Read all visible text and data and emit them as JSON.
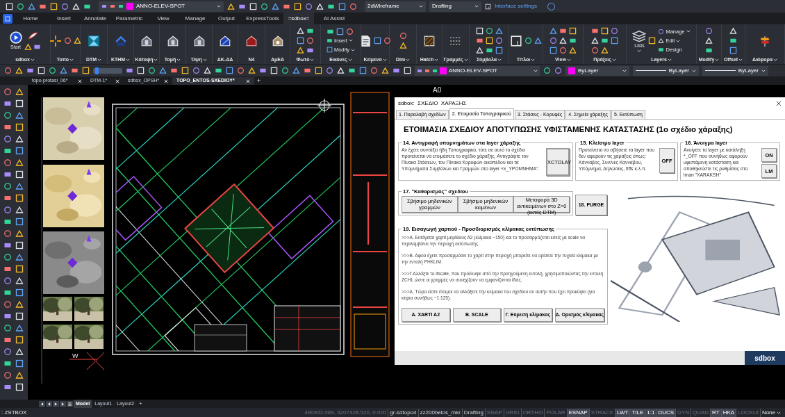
{
  "quick_access": {
    "layer": "ANNO-ELEV-SPOT",
    "visual_style": "2dWireframe",
    "workspace": "Drafting",
    "link": "Interface settings"
  },
  "ribbon_tabs": [
    {
      "label": "Home",
      "selected": false
    },
    {
      "label": "Insert",
      "selected": false
    },
    {
      "label": "Annotate",
      "selected": false
    },
    {
      "label": "Parametric",
      "selected": false
    },
    {
      "label": "View",
      "selected": false
    },
    {
      "label": "Manage",
      "selected": false
    },
    {
      "label": "Output",
      "selected": false
    },
    {
      "label": "ExpressTools",
      "selected": false
    },
    {
      "label": "=sdbox=",
      "selected": true
    },
    {
      "label": "AI Assist",
      "selected": false
    }
  ],
  "ribbon_panels": [
    {
      "label": "sdbox",
      "dropdown": true,
      "items": [
        {
          "kind": "caption",
          "label": "Start"
        }
      ]
    },
    {
      "label": "Τοπο",
      "dropdown": true
    },
    {
      "label": "DTM",
      "dropdown": true
    },
    {
      "label": "ΚΤΗΜ",
      "dropdown": true
    },
    {
      "label": "Κάτοψη",
      "dropdown": true
    },
    {
      "label": "Τομή",
      "dropdown": true
    },
    {
      "label": "Όψη",
      "dropdown": true
    },
    {
      "label": "ΔΚ-ΔΔ",
      "dropdown": false
    },
    {
      "label": "Ν4",
      "dropdown": false
    },
    {
      "label": "ΑμΕΑ",
      "dropdown": false
    },
    {
      "label": "Φωτό",
      "dropdown": true
    },
    {
      "label": "Εικόνες",
      "dropdown": true,
      "items": [
        {
          "kind": "row",
          "label": "Insert",
          "dropdown": true
        },
        {
          "kind": "row",
          "label": "Modify",
          "dropdown": true
        }
      ]
    },
    {
      "label": "Κείμενα",
      "dropdown": true
    },
    {
      "label": "Dim",
      "dropdown": true
    },
    {
      "label": "Hatch",
      "dropdown": true
    },
    {
      "label": "Γραμμές",
      "dropdown": true
    },
    {
      "label": "Σύμβολα",
      "dropdown": true
    },
    {
      "label": "Τίτλοι",
      "dropdown": true
    },
    {
      "label": "View",
      "dropdown": true
    },
    {
      "label": "Πράξεις",
      "dropdown": true
    },
    {
      "label": "Layers",
      "dropdown": true,
      "items": [
        {
          "kind": "caption",
          "label": "Lists",
          "dropdown": true
        },
        {
          "kind": "row",
          "label": "Manage",
          "dropdown": true
        },
        {
          "kind": "row",
          "label": "Edit",
          "dropdown": true
        },
        {
          "kind": "row",
          "label": "Design",
          "dropdown": false
        }
      ]
    },
    {
      "label": "Modify",
      "dropdown": true
    },
    {
      "label": "Offset",
      "dropdown": true
    },
    {
      "label": "Διάφορα",
      "dropdown": true
    }
  ],
  "properties_bar": {
    "zoom_slider": {
      "level": 0.08
    },
    "layer": "ANNO-ELEV-SPOT",
    "color_setting": "ByLayer",
    "linetype": "ByLayer",
    "lineweight": "ByLayer"
  },
  "document_tabs": [
    {
      "label": "topo-protasi_06*",
      "selected": false
    },
    {
      "label": "DTM-1*",
      "selected": false
    },
    {
      "label": "sdbox_OPSH*",
      "selected": false
    },
    {
      "label": "TOPO_ENTOS-SXEDIOY*",
      "selected": true
    }
  ],
  "new_tab": "+",
  "drawing": {
    "sheet_label": "A0",
    "north_label": "W"
  },
  "dialog": {
    "title": "sdbox:  ΣΧΕΔΙΟ  ΧΑΡΑΞΗΣ",
    "tabs": [
      {
        "label": "1. Παραλαβή σχεδίων",
        "selected": false
      },
      {
        "label": "2. Ετοιμασία Τοπογραφικού",
        "selected": true
      },
      {
        "label": "3. Στάσεις - Κορυφές",
        "selected": false
      },
      {
        "label": "4. Σημεία χάραξης",
        "selected": false
      },
      {
        "label": "5. Εκτύπωση",
        "selected": false
      }
    ],
    "heading": "ΕΤΟΙΜΑΣΙΑ ΣΧΕΔΙΟΥ ΑΠΟΤΥΠΩΣΗΣ ΥΦΙΣΤΑΜΕΝΗΣ ΚΑΤΑΣΤΑΣΗΣ (1ο σχέδιο χάραξης)",
    "top_groups": [
      {
        "title": "14. Αντιγραφή υπομνημάτων στα layer χάραξης",
        "text": "Αν έχετε συντάξει ήδη Τοπογραφικό, τότε σε αυτό το σχέδιο προτείνεται να ετοιμάσετε το σχέδιο χάραξης. Αντιγράψτε τον Πίνακα Στάσεων, τον Πίνακα Κορυφών οικοπέδου και τα Υπομνήματα Συμβόλων και Γραμμών στο layer «x_YPOMNHMA\".",
        "buttons": [
          "XCTOLAY"
        ]
      },
      {
        "title": "15. Κλείσιμο  layer",
        "text": "Προτείνεται να σβήσετε τα layer που δεν αφορούν τις χαράξεις όπως: Κάνναβος, Συν/νες Κανναβου, Υπόμνημα, Δηλώσεις, tiffs κ.λ.π.",
        "buttons": [
          "OFF"
        ]
      },
      {
        "title": "16. Άνοιγμα  layer",
        "text": "Ανοίγετε τα layer με κατάληξη *_OFF που συνήθως αφορούν υφιστάμενη κατάσταση και αποθηκεύστε τις ρυθμίσεις στο lman \"XARAKSH\"",
        "buttons": [
          "ON",
          "LM"
        ]
      }
    ],
    "cleanup": {
      "title": "17.  \"Καθαρισμός\" σχεδίου",
      "buttons": [
        "Σβήσιμο μηδενικών γραμμών",
        "Σβήσιμο μηδενικών κειμένων",
        "Μεταφορά 3D αντικειμένων στο Z=0   (εκτός DTM)"
      ]
    },
    "purge_button": "18. PURGE",
    "paper": {
      "title": "19. Εισαγωγή χαρτιού - Προσδιορισμός κλίμακας εκτύπωσης",
      "paragraphs": [
        ">>>Α. Εισάγεται χαρτί μεγέθους Α2 (κλίμακα ~150) και το προσαρμόζεται εσείς με scale να περιλαμβάνει την περιοχή εκτύπωσης.",
        ">>>Β. Αφού έχετε προσαρμόσει το χαρτί στην περιοχή μπορείτε να ορίσετε την τυχαία κλίμακα με την εντολή PHKLIM.",
        ">>>Γ.Αλλάξτε το ltscale, που προέκυψε από την προηγούμενη εντολή, χρησιμοποιώντας την εντολή ZCHL ώστε οι γραμμές να συνεχίζουν να εμφανίζονται ίδιες.",
        ">>>Δ. Τώρα είστε έτοιμοι να αλλάξετε την κλίμακα του σχεδίου σε αυτήν που έχει προκύψει (για κτίρια συνήθως ~1:125)."
      ],
      "buttons": [
        "Α.  XARTI A2",
        "Β. SCALE",
        "Γ. Εύρεση κλίμακας",
        "Δ.  Ορισμός κλίμακας"
      ]
    },
    "logo": "sdbox"
  },
  "layout_tabs": [
    {
      "label": "Model",
      "selected": true
    },
    {
      "label": "Layout1",
      "selected": false
    },
    {
      "label": "Layout2",
      "selected": false
    }
  ],
  "new_layout": "+",
  "command_line": ": ZSTBOX",
  "status_bar": {
    "coordinates": "490942.089, 4207428.520, 0.000",
    "fields": [
      "gr-sdtopo4",
      "zz200belos_mkr",
      "Drafting"
    ],
    "toggles": [
      {
        "label": "SNAP",
        "on": false
      },
      {
        "label": "GRID",
        "on": false
      },
      {
        "label": "ORTHO",
        "on": false
      },
      {
        "label": "POLAR",
        "on": false
      },
      {
        "label": "ESNAP",
        "on": true
      },
      {
        "label": "STRACK",
        "on": false
      },
      {
        "label": "LWT",
        "on": true
      },
      {
        "label": "TILE",
        "on": true
      },
      {
        "label": "1:1",
        "on": true
      },
      {
        "label": "DUCS",
        "on": true
      },
      {
        "label": "DYN",
        "on": false
      },
      {
        "label": "QUAD",
        "on": false
      },
      {
        "label": "RT",
        "on": true
      },
      {
        "label": "HKA",
        "on": true
      },
      {
        "label": "LOCKUI",
        "on": false
      }
    ],
    "annotation_scale": "None"
  }
}
